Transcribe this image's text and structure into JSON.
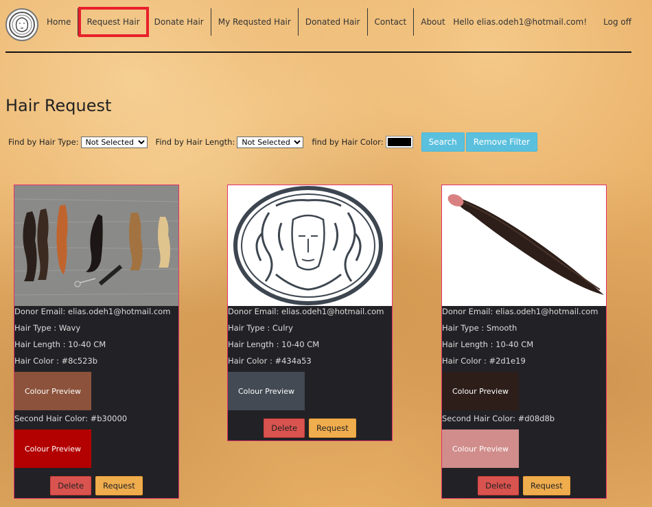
{
  "nav": {
    "items": [
      "Home",
      "Request Hair",
      "Donate Hair",
      "My Requsted Hair",
      "Donated Hair",
      "Contact",
      "About"
    ],
    "greeting": "Hello elias.odeh1@hotmail.com!",
    "logoff": "Log off"
  },
  "page": {
    "title": "Hair Request"
  },
  "filters": {
    "type_label": "Find by Hair Type:",
    "type_value": "Not Selected",
    "length_label": "Find by Hair Length:",
    "length_value": "Not Selected",
    "color_label": "find by Hair Color:",
    "color_value": "#000000",
    "search_label": "Search",
    "remove_label": "Remove Filter"
  },
  "cards": [
    {
      "donor": "Donor Email: elias.odeh1@hotmail.com",
      "type": "Hair Type : Wavy",
      "length": "Hair Length : 10-40 CM",
      "color": "Hair Color : #8c523b",
      "color_hex": "#8c523b",
      "preview_label": "Colour Preview",
      "second_color": "Second Hair Color: #b30000",
      "second_hex": "#b30000",
      "second_preview_label": "Colour Preview",
      "delete_label": "Delete",
      "request_label": "Request",
      "image": "hair-samples-photo"
    },
    {
      "donor": "Donor Email: elias.odeh1@hotmail.com",
      "type": "Hair Type : Culry",
      "length": "Hair Length : 10-40 CM",
      "color": "Hair Color : #434a53",
      "color_hex": "#434a53",
      "preview_label": "Colour Preview",
      "delete_label": "Delete",
      "request_label": "Request",
      "image": "medusa-logo"
    },
    {
      "donor": "Donor Email: elias.odeh1@hotmail.com",
      "type": "Hair Type : Smooth",
      "length": "Hair Length : 10-40 CM",
      "color": "Hair Color : #2d1e19",
      "color_hex": "#2d1e19",
      "preview_label": "Colour Preview",
      "second_color": "Second Hair Color: #d08d8b",
      "second_hex": "#d08d8b",
      "second_preview_label": "Colour Preview",
      "delete_label": "Delete",
      "request_label": "Request",
      "image": "hair-bundle-photo"
    }
  ]
}
